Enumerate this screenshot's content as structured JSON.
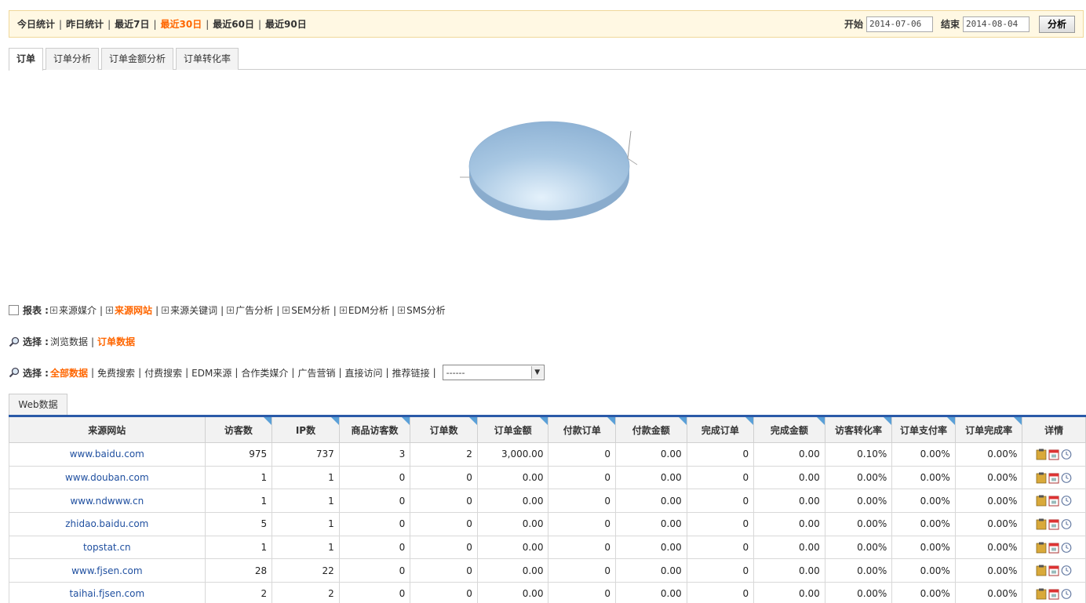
{
  "range_links": [
    {
      "label": "今日统计",
      "active": false
    },
    {
      "label": "昨日统计",
      "active": false
    },
    {
      "label": "最近7日",
      "active": false
    },
    {
      "label": "最近30日",
      "active": true
    },
    {
      "label": "最近60日",
      "active": false
    },
    {
      "label": "最近90日",
      "active": false
    }
  ],
  "date": {
    "start_label": "开始",
    "start_value": "2014-07-06",
    "end_label": "结束",
    "end_value": "2014-08-04",
    "analyze_label": "分析"
  },
  "tabs": [
    {
      "label": "订单",
      "active": true
    },
    {
      "label": "订单分析",
      "active": false
    },
    {
      "label": "订单金额分析",
      "active": false
    },
    {
      "label": "订单转化率",
      "active": false
    }
  ],
  "chart_data": {
    "type": "pie",
    "values": [
      100
    ],
    "colors": [
      "#9dbfdf"
    ]
  },
  "report": {
    "lead": "报表 :",
    "items": [
      {
        "label": "来源媒介",
        "active": false
      },
      {
        "label": "来源网站",
        "active": true
      },
      {
        "label": "来源关键词",
        "active": false
      },
      {
        "label": "广告分析",
        "active": false
      },
      {
        "label": "SEM分析",
        "active": false
      },
      {
        "label": "EDM分析",
        "active": false
      },
      {
        "label": "SMS分析",
        "active": false
      }
    ]
  },
  "select1": {
    "lead": "选择 :",
    "items": [
      {
        "label": "浏览数据",
        "active": false
      },
      {
        "label": "订单数据",
        "active": true
      }
    ]
  },
  "select2": {
    "lead": "选择 :",
    "items": [
      {
        "label": "全部数据",
        "active": true
      },
      {
        "label": "免费搜索",
        "active": false
      },
      {
        "label": "付费搜索",
        "active": false
      },
      {
        "label": "EDM来源",
        "active": false
      },
      {
        "label": "合作类媒介",
        "active": false
      },
      {
        "label": "广告营销",
        "active": false
      },
      {
        "label": "直接访问",
        "active": false
      },
      {
        "label": "推荐链接",
        "active": false
      }
    ],
    "dropdown_value": "------"
  },
  "web_tab": "Web数据",
  "table": {
    "headers": [
      "来源网站",
      "访客数",
      "IP数",
      "商品访客数",
      "订单数",
      "订单金额",
      "付款订单",
      "付款金额",
      "完成订单",
      "完成金额",
      "访客转化率",
      "订单支付率",
      "订单完成率",
      "详情"
    ],
    "rows": [
      [
        "www.baidu.com",
        "975",
        "737",
        "3",
        "2",
        "3,000.00",
        "0",
        "0.00",
        "0",
        "0.00",
        "0.10%",
        "0.00%",
        "0.00%"
      ],
      [
        "www.douban.com",
        "1",
        "1",
        "0",
        "0",
        "0.00",
        "0",
        "0.00",
        "0",
        "0.00",
        "0.00%",
        "0.00%",
        "0.00%"
      ],
      [
        "www.ndwww.cn",
        "1",
        "1",
        "0",
        "0",
        "0.00",
        "0",
        "0.00",
        "0",
        "0.00",
        "0.00%",
        "0.00%",
        "0.00%"
      ],
      [
        "zhidao.baidu.com",
        "5",
        "1",
        "0",
        "0",
        "0.00",
        "0",
        "0.00",
        "0",
        "0.00",
        "0.00%",
        "0.00%",
        "0.00%"
      ],
      [
        "topstat.cn",
        "1",
        "1",
        "0",
        "0",
        "0.00",
        "0",
        "0.00",
        "0",
        "0.00",
        "0.00%",
        "0.00%",
        "0.00%"
      ],
      [
        "www.fjsen.com",
        "28",
        "22",
        "0",
        "0",
        "0.00",
        "0",
        "0.00",
        "0",
        "0.00",
        "0.00%",
        "0.00%",
        "0.00%"
      ],
      [
        "taihai.fjsen.com",
        "2",
        "2",
        "0",
        "0",
        "0.00",
        "0",
        "0.00",
        "0",
        "0.00",
        "0.00%",
        "0.00%",
        "0.00%"
      ]
    ]
  }
}
